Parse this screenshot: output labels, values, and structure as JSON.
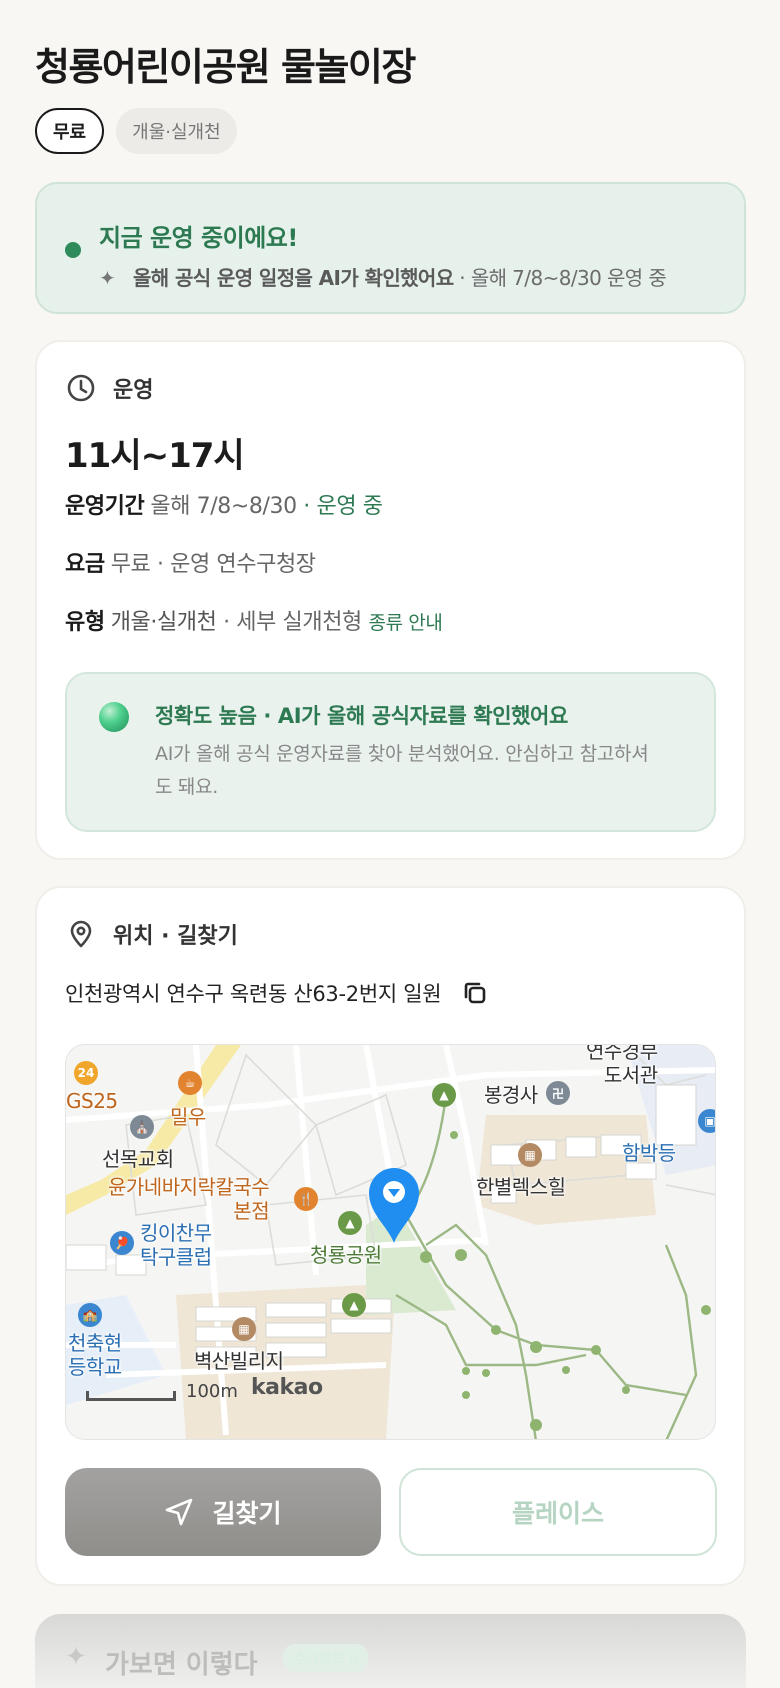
{
  "title": "청룡어린이공원 물놀이장",
  "chips": {
    "price": "무료",
    "type": "개울·실개천"
  },
  "status": {
    "headline": "지금 운영 중이에요!",
    "sub_bold": "올해 공식 운영 일정을 AI가 확인했어요",
    "sub_rest": " · 올해 7/8~8/30 운영 중",
    "color": "#2d7a52"
  },
  "operation": {
    "section_label": "운영",
    "hours": "11시~17시",
    "period_key": "운영기간",
    "period_val": "올해 7/8~8/30",
    "period_status": " · 운영 중",
    "fee_key": "요금",
    "fee_val": "무료 · 운영 연수구청장",
    "type_key": "유형",
    "type_val": "개울·실개천",
    "type_detail": " · 세부 실개천형 ",
    "type_link": "종류 안내"
  },
  "accuracy": {
    "headline": "정확도 높음 · AI가 올해 공식자료를 확인했어요",
    "body": "AI가 올해 공식 운영자료를 찾아 분석했어요. 안심하고 참고하셔도 돼요."
  },
  "location": {
    "section_label": "위치 · 길찾기",
    "address": "인천광역시 연수구 옥련동 산63-2번지 일원",
    "map": {
      "labels": {
        "gs25": "GS25",
        "milwoo": "밀우",
        "church": "선목교회",
        "restaurant": "윤가네바지락칼국수\n본점",
        "pingpong": "킹이찬무\n탁구클럽",
        "school": "천축현\n등학교",
        "villa": "벽산빌리지",
        "park": "청룡공원",
        "temple": "봉경사",
        "hill": "한별렉스힐",
        "library": "연수경부\n도서관",
        "museum": "함박등"
      },
      "scale": "100m",
      "provider": "kakao"
    },
    "directions_button": "길찾기",
    "place_button": "플레이스"
  },
  "peek": {
    "title": "가보면 이렇다",
    "badge": "추가정보 0"
  }
}
